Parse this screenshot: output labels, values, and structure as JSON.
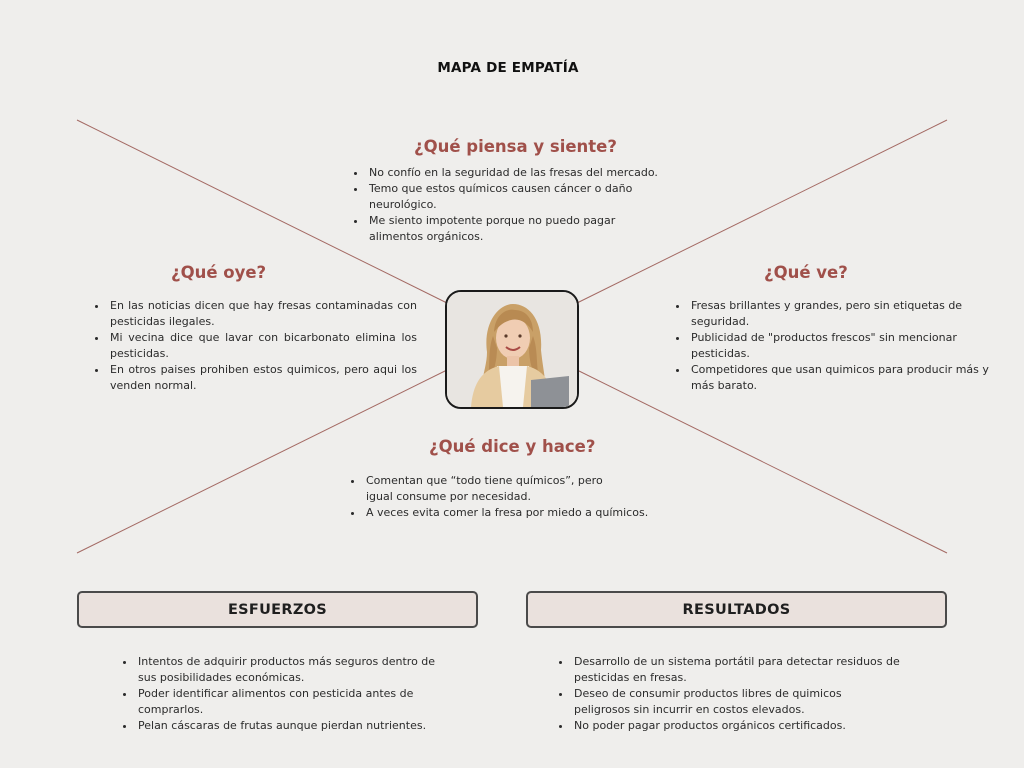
{
  "title": "MAPA DE EMPATÍA",
  "quadrants": {
    "thinks": {
      "heading": "¿Qué piensa y siente?",
      "items": [
        "No confío en la seguridad de las fresas del mercado.",
        "Temo que estos químicos causen cáncer o daño neurológico.",
        "Me siento impotente porque no puedo pagar alimentos orgánicos."
      ]
    },
    "hears": {
      "heading": "¿Qué oye?",
      "items": [
        "En las noticias dicen que hay fresas contaminadas con pesticidas ilegales.",
        "Mi vecina dice que lavar con bicarbonato elimina los pesticidas.",
        "En otros paises prohiben estos quimicos, pero aqui los venden normal."
      ]
    },
    "sees": {
      "heading": "¿Qué ve?",
      "items": [
        "Fresas brillantes y grandes, pero sin etiquetas de seguridad.",
        "Publicidad de \"productos frescos\" sin mencionar pesticidas.",
        "Competidores que usan quimicos para producir más y más barato."
      ]
    },
    "says": {
      "heading": "¿Qué dice y hace?",
      "items": [
        "Comentan que “todo tiene químicos”, pero igual consume por necesidad.",
        "A veces evita  comer la fresa por miedo a químicos."
      ]
    }
  },
  "efforts": {
    "label": "ESFUERZOS",
    "items": [
      "Intentos de adquirir productos más seguros dentro de sus posibilidades económicas.",
      "Poder identificar alimentos con pesticida antes de comprarlos.",
      "Pelan cáscaras de frutas aunque pierdan nutrientes."
    ]
  },
  "results": {
    "label": "RESULTADOS",
    "items": [
      "Desarrollo de un sistema portátil para detectar residuos de pesticidas en fresas.",
      "Deseo de consumir productos libres de quimicos peligrosos sin incurrir en costos elevados.",
      "No poder pagar productos orgánicos certificados."
    ]
  },
  "colors": {
    "background": "#efeeec",
    "heading": "#a0504a",
    "lines": "#a46a64",
    "box_fill": "#eae1dd",
    "box_border": "#4a4a4a"
  }
}
